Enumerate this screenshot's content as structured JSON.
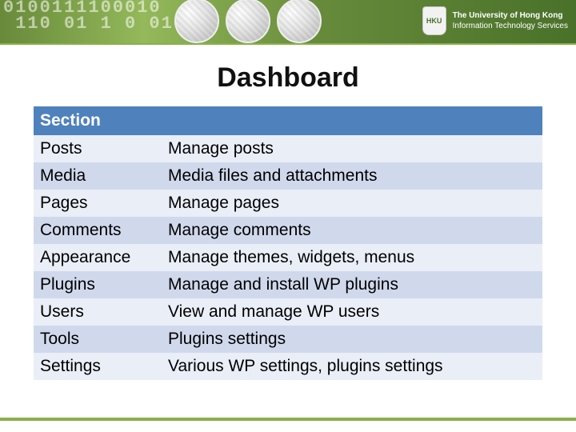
{
  "org": {
    "line1": "The University of Hong Kong",
    "line2": "Information Technology Services",
    "shield_text": "HKU"
  },
  "title": "Dashboard",
  "table": {
    "header": {
      "col1": "Section",
      "col2": ""
    },
    "rows": [
      {
        "section": "Posts",
        "desc": "Manage posts"
      },
      {
        "section": "Media",
        "desc": "Media files and attachments"
      },
      {
        "section": "Pages",
        "desc": "Manage pages"
      },
      {
        "section": "Comments",
        "desc": "Manage comments"
      },
      {
        "section": "Appearance",
        "desc": "Manage themes, widgets, menus"
      },
      {
        "section": "Plugins",
        "desc": "Manage and install WP plugins"
      },
      {
        "section": "Users",
        "desc": "View and manage WP users"
      },
      {
        "section": "Tools",
        "desc": "Plugins settings"
      },
      {
        "section": "Settings",
        "desc": "Various WP settings, plugins settings"
      }
    ]
  },
  "banner_bits": "0100111100010\n 110 01 1 0 010 1"
}
